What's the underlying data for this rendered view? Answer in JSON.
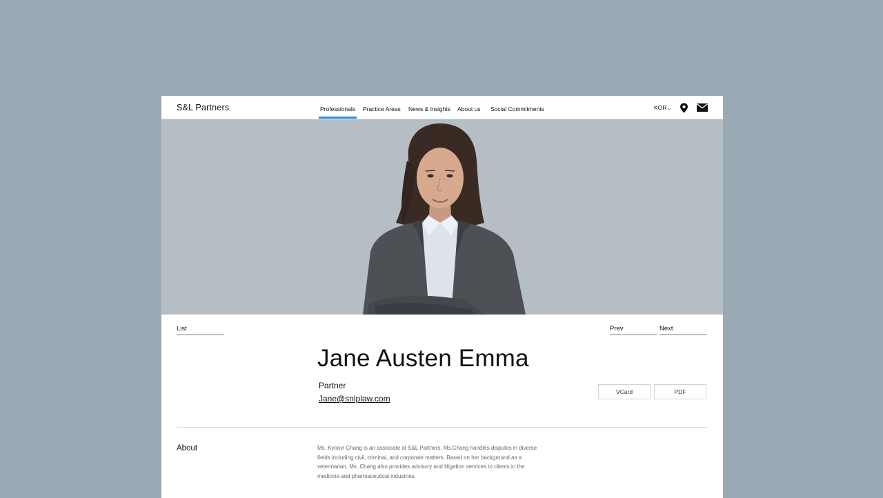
{
  "brand": {
    "logo": "S&L Partners"
  },
  "nav": {
    "items": [
      {
        "label": "Professionals",
        "active": true
      },
      {
        "label": "Practice Areas",
        "active": false
      },
      {
        "label": "News & Insights",
        "active": false
      },
      {
        "label": "About us",
        "active": false
      },
      {
        "label": "Social Commitments",
        "active": false
      }
    ],
    "language": "KOR",
    "accent_color": "#2a90e0"
  },
  "icons": {
    "location": "location-pin-icon",
    "mail": "mail-icon",
    "language_dropdown": "chevron-down-icon"
  },
  "controls": {
    "list_label": "List",
    "prev_label": "Prev",
    "next_label": "Next"
  },
  "profile": {
    "name": "Jane Austen Emma",
    "title": "Partner",
    "email": "Jane@snlplaw.com",
    "vcard_label": "VCard",
    "pdf_label": "PDF"
  },
  "about": {
    "heading": "About",
    "body": "Ms. Kyooyi Chang is an associate at S&L Partners. Ms.Chang handles disputes in diverse fields including civil, criminal, and corporate matters. Based on her background as a veterinarian, Ms. Chang also provides advisory and litigation services to clients in the medicine and pharmaceutical industries."
  },
  "colors": {
    "backdrop": "#9aaab4",
    "hero_background": "#b6bec5"
  }
}
